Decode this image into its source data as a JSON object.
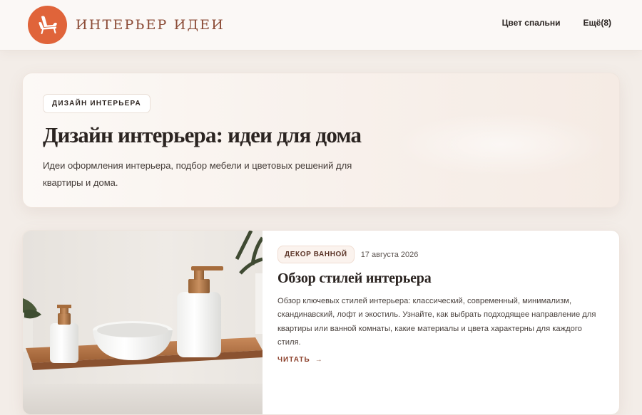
{
  "header": {
    "logo_text": "ИНТЕРЬЕР ИДЕИ",
    "logo_icon": "armchair-icon",
    "nav": [
      {
        "label": "Цвет спальни"
      },
      {
        "label": "Ещё(8)"
      }
    ]
  },
  "hero": {
    "badge": "ДИЗАЙН ИНТЕРЬЕРА",
    "title": "Дизайн интерьера: идеи для дома",
    "description": "Идеи оформления интерьера, подбор мебели и цветовых решений для квартиры и дома."
  },
  "article": {
    "category": "ДЕКОР ВАННОЙ",
    "date": "17 августа 2026",
    "title": "Обзор стилей интерьера",
    "excerpt": "Обзор ключевых стилей интерьера: классический, современный, минимализм, скандинавский, лофт и экостиль. Узнайте, как выбрать подходящее направление для квартиры или ванной комнаты, какие материалы и цвета характерны для каждого стиля.",
    "read_more": "ЧИТАТЬ",
    "read_more_arrow": "→"
  },
  "colors": {
    "accent": "#e0643a",
    "brand_text": "#8b4a35",
    "page_bg": "#f3ede8"
  }
}
